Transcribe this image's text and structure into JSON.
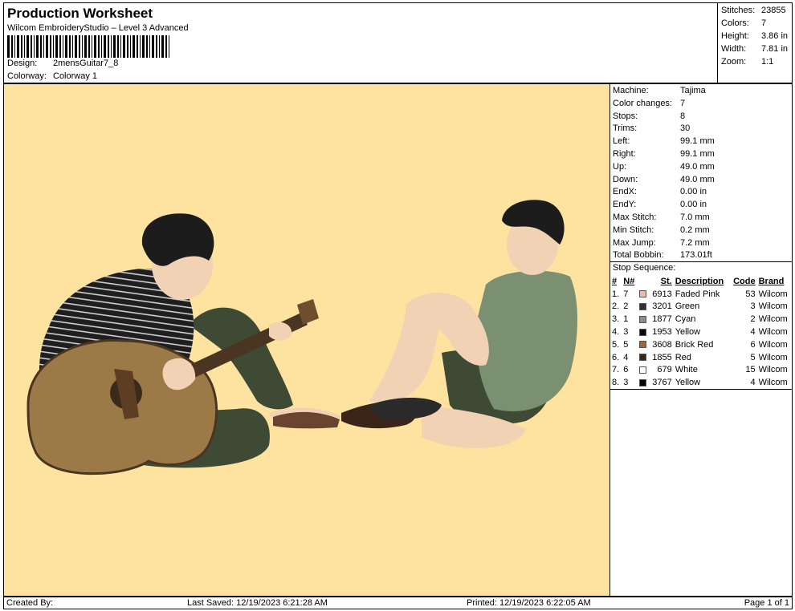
{
  "header": {
    "title": "Production Worksheet",
    "subtitle": "Wilcom EmbroideryStudio – Level 3 Advanced",
    "design_label": "Design:",
    "design_value": "2mensGuitar7_8",
    "colorway_label": "Colorway:",
    "colorway_value": "Colorway 1"
  },
  "summary": [
    {
      "label": "Stitches:",
      "value": "23855"
    },
    {
      "label": "Colors:",
      "value": "7"
    },
    {
      "label": "Height:",
      "value": "3.86 in"
    },
    {
      "label": "Width:",
      "value": "7.81 in"
    },
    {
      "label": "Zoom:",
      "value": "1:1"
    }
  ],
  "details": [
    {
      "label": "Machine:",
      "value": "Tajima"
    },
    {
      "label": "Color changes:",
      "value": "7"
    },
    {
      "label": "Stops:",
      "value": "8"
    },
    {
      "label": "Trims:",
      "value": "30"
    },
    {
      "label": "Left:",
      "value": "99.1 mm"
    },
    {
      "label": "Right:",
      "value": "99.1 mm"
    },
    {
      "label": "Up:",
      "value": "49.0 mm"
    },
    {
      "label": "Down:",
      "value": "49.0 mm"
    },
    {
      "label": "EndX:",
      "value": "0.00 in"
    },
    {
      "label": "EndY:",
      "value": "0.00 in"
    },
    {
      "label": "Max Stitch:",
      "value": "7.0 mm"
    },
    {
      "label": "Min Stitch:",
      "value": "0.2 mm"
    },
    {
      "label": "Max Jump:",
      "value": "7.2 mm"
    },
    {
      "label": "Total Bobbin:",
      "value": "173.01ft"
    }
  ],
  "stop_sequence": {
    "title": "Stop Sequence:",
    "columns": [
      "#",
      "N#",
      "St.",
      "Description",
      "Code",
      "Brand"
    ],
    "rows": [
      {
        "num": "1.",
        "n": "7",
        "color": "#f2b9a0",
        "st": "6913",
        "desc": "Faded Pink",
        "code": "53",
        "brand": "Wilcom"
      },
      {
        "num": "2.",
        "n": "2",
        "color": "#2f2f2f",
        "st": "3201",
        "desc": "Green",
        "code": "3",
        "brand": "Wilcom"
      },
      {
        "num": "3.",
        "n": "1",
        "color": "#8c8c8c",
        "st": "1877",
        "desc": "Cyan",
        "code": "2",
        "brand": "Wilcom"
      },
      {
        "num": "4.",
        "n": "3",
        "color": "#0a0a0a",
        "st": "1953",
        "desc": "Yellow",
        "code": "4",
        "brand": "Wilcom"
      },
      {
        "num": "5.",
        "n": "5",
        "color": "#9a6a3e",
        "st": "3608",
        "desc": "Brick Red",
        "code": "6",
        "brand": "Wilcom"
      },
      {
        "num": "6.",
        "n": "4",
        "color": "#3b2418",
        "st": "1855",
        "desc": "Red",
        "code": "5",
        "brand": "Wilcom"
      },
      {
        "num": "7.",
        "n": "6",
        "color": "#ffffff",
        "st": "679",
        "desc": "White",
        "code": "15",
        "brand": "Wilcom"
      },
      {
        "num": "8.",
        "n": "3",
        "color": "#050505",
        "st": "3767",
        "desc": "Yellow",
        "code": "4",
        "brand": "Wilcom"
      }
    ]
  },
  "canvas": {
    "background": "#fde39f"
  },
  "footer": {
    "created_by": "Created By:",
    "last_saved": "Last Saved: 12/19/2023 6:21:28 AM",
    "printed": "Printed: 12/19/2023 6:22:05 AM",
    "page": "Page 1 of 1"
  }
}
